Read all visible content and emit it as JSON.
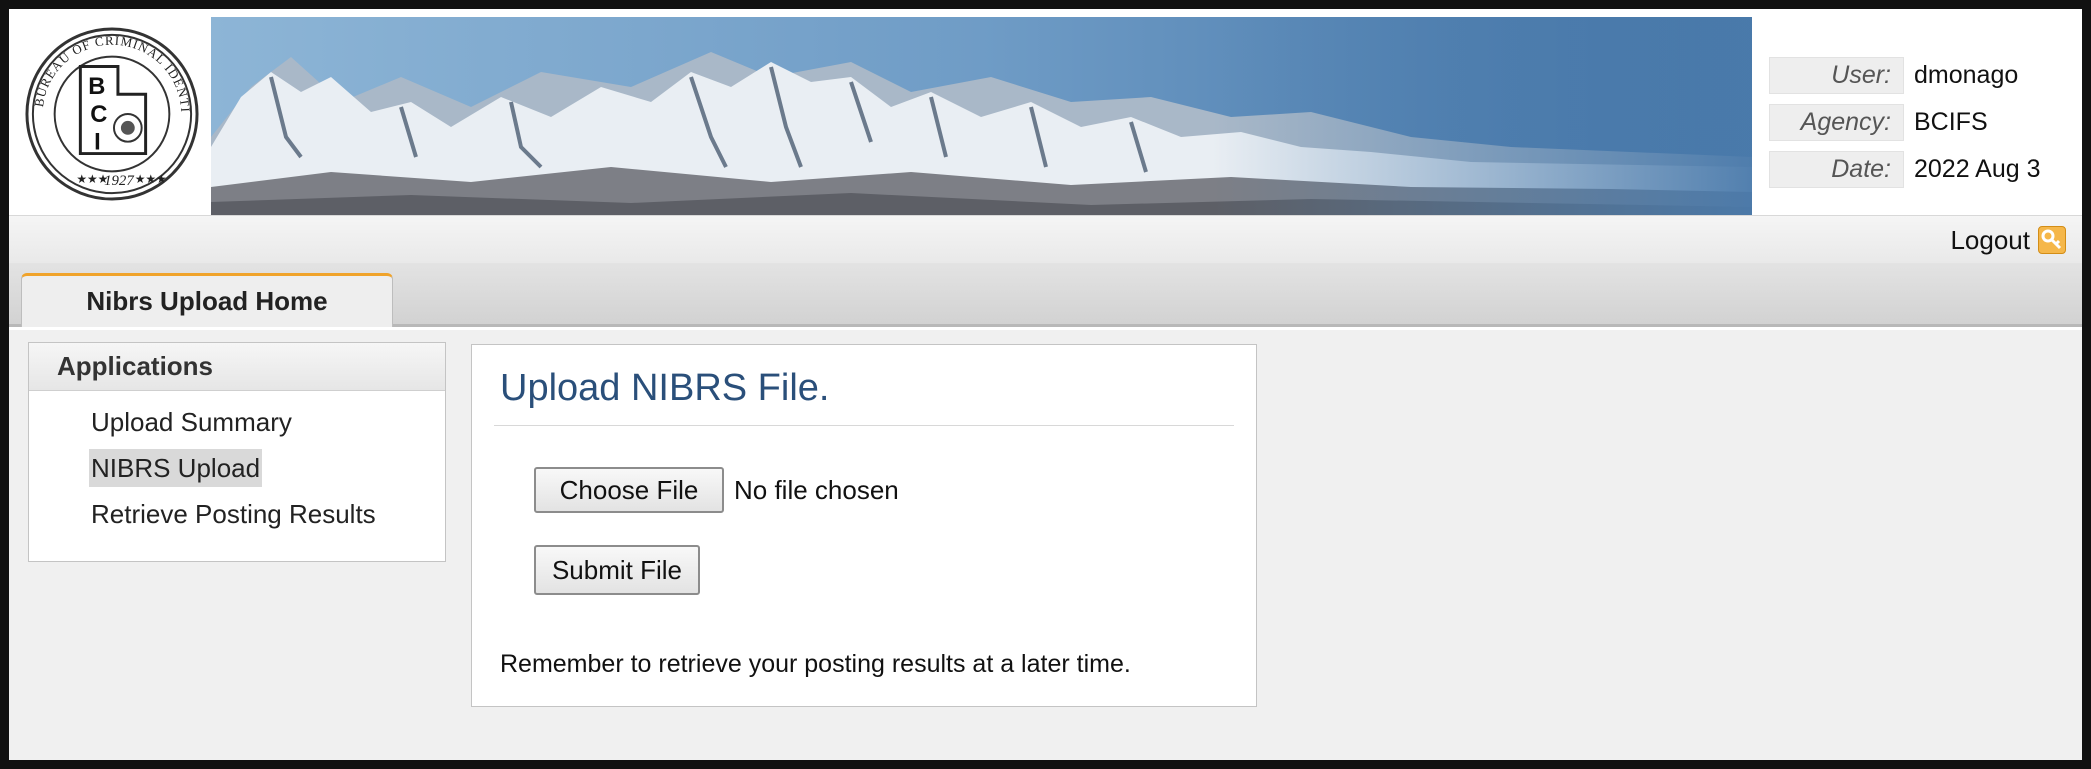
{
  "header": {
    "logo_text": "BUREAU OF CRIMINAL IDENTIFICATION",
    "logo_letters": "BCI",
    "logo_year": "1927",
    "user_label": "User:",
    "user_value": "dmonago",
    "agency_label": "Agency:",
    "agency_value": "BCIFS",
    "date_label": "Date:",
    "date_value": "2022 Aug 3"
  },
  "logout": {
    "label": "Logout",
    "icon": "key-icon"
  },
  "tabs": [
    {
      "label": "Nibrs Upload Home",
      "active": true
    }
  ],
  "sidebar": {
    "title": "Applications",
    "items": [
      {
        "label": "Upload Summary",
        "active": false
      },
      {
        "label": "NIBRS Upload",
        "active": true
      },
      {
        "label": "Retrieve Posting Results",
        "active": false
      }
    ]
  },
  "upload": {
    "title": "Upload NIBRS File.",
    "choose_file_label": "Choose File",
    "no_file_text": "No file chosen",
    "submit_label": "Submit File",
    "reminder": "Remember to retrieve your posting results at a later time."
  },
  "colors": {
    "banner_sky": "#4f7fae",
    "tab_accent": "#f0a32a",
    "title_blue": "#2a4f7a"
  }
}
